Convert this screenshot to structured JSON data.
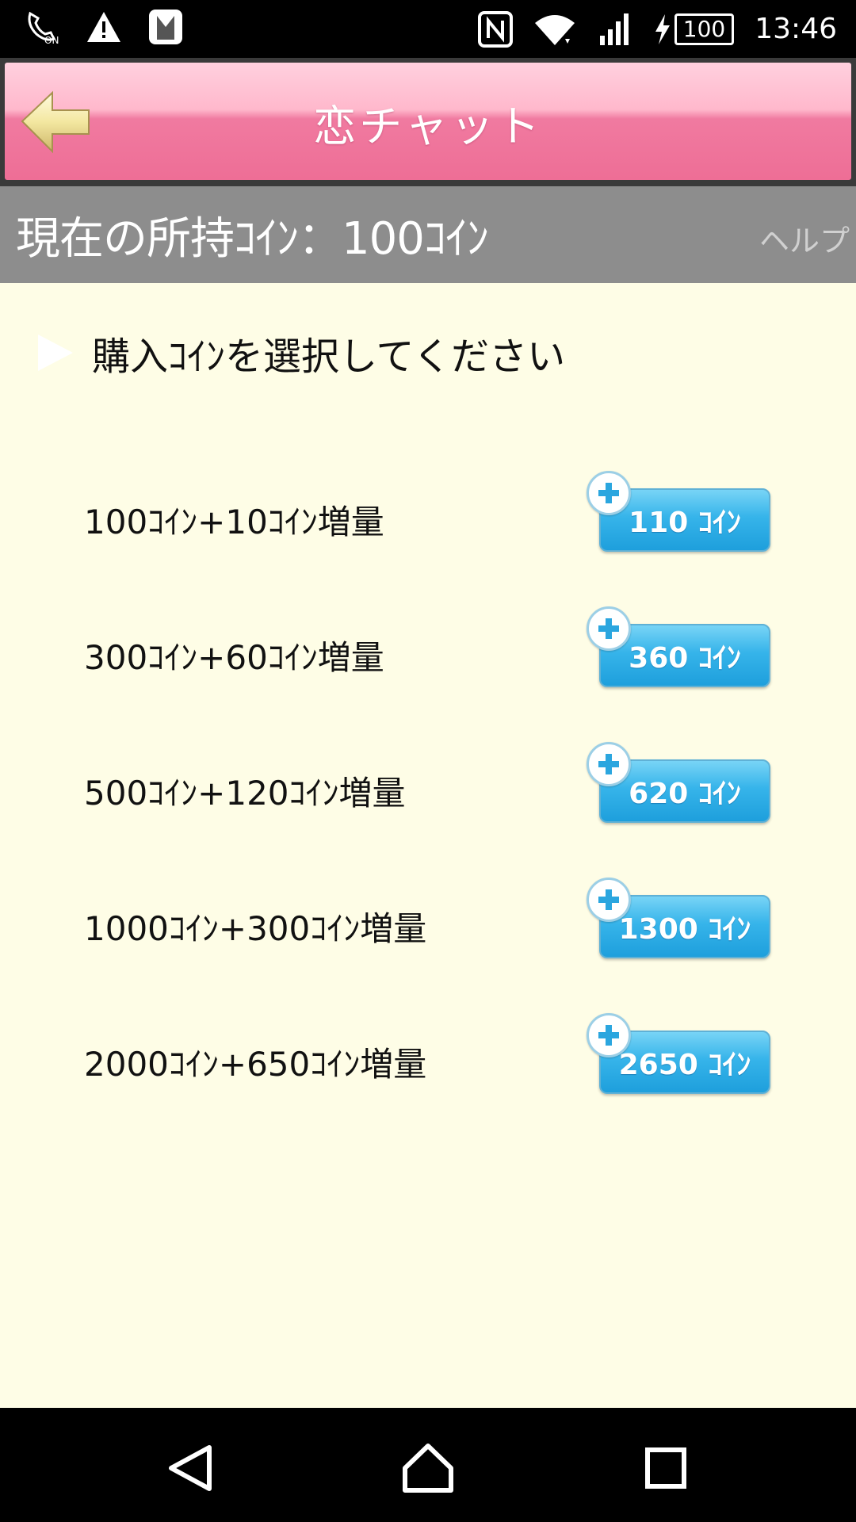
{
  "status_bar": {
    "time": "13:46",
    "battery": "100",
    "on_badge": "ON"
  },
  "header": {
    "title": "恋チャット"
  },
  "coin_bar": {
    "current_coins": "現在の所持ｺｲﾝ：100ｺｲﾝ",
    "help": "ヘルプ"
  },
  "section": {
    "heading": "購入ｺｲﾝを選択してください"
  },
  "packages": [
    {
      "label": "100ｺｲﾝ+10ｺｲﾝ増量",
      "button": "110 ｺｲﾝ"
    },
    {
      "label": "300ｺｲﾝ+60ｺｲﾝ増量",
      "button": "360 ｺｲﾝ"
    },
    {
      "label": "500ｺｲﾝ+120ｺｲﾝ増量",
      "button": "620 ｺｲﾝ"
    },
    {
      "label": "1000ｺｲﾝ+300ｺｲﾝ増量",
      "button": "1300 ｺｲﾝ"
    },
    {
      "label": "2000ｺｲﾝ+650ｺｲﾝ増量",
      "button": "2650 ｺｲﾝ"
    }
  ],
  "colors": {
    "header_pink": "#ee6e96",
    "button_blue": "#36b4ea",
    "background": "#fefde6",
    "coin_bar": "#8d8d8d"
  }
}
